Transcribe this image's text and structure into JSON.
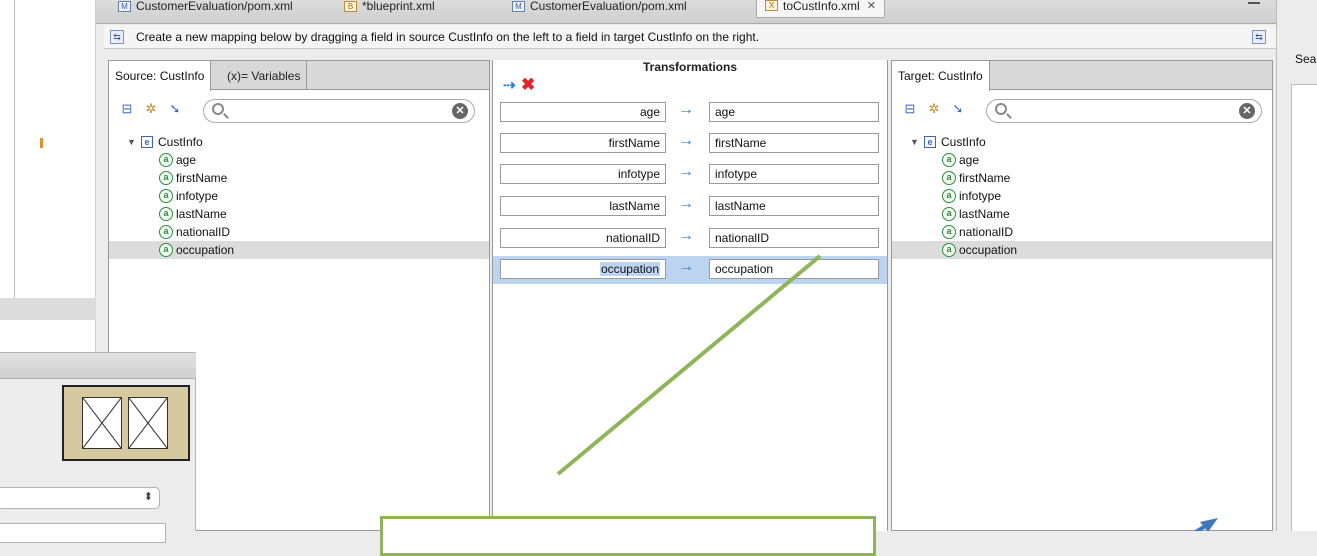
{
  "tabs": [
    {
      "label": "CustomerEvaluation/pom.xml",
      "icon": "M",
      "active": false
    },
    {
      "label": "*blueprint.xml",
      "icon": "B",
      "active": false
    },
    {
      "label": "CustomerEvaluation/pom.xml",
      "icon": "M",
      "active": false
    },
    {
      "label": "toCustInfo.xml",
      "icon": "X",
      "active": true
    }
  ],
  "info_bar": {
    "text": "Create a new mapping below by dragging a field in source CustInfo on the left to a field in target CustInfo on the right."
  },
  "source_panel": {
    "tab_label": "Source: CustInfo",
    "variables_tab_label": "(x)= Variables",
    "root": "CustInfo",
    "fields": [
      "age",
      "firstName",
      "infotype",
      "lastName",
      "nationalID",
      "occupation"
    ],
    "selected": "occupation"
  },
  "transformations": {
    "title": "Transformations",
    "mappings": [
      {
        "source": "age",
        "target": "age"
      },
      {
        "source": "firstName",
        "target": "firstName"
      },
      {
        "source": "infotype",
        "target": "infotype"
      },
      {
        "source": "lastName",
        "target": "lastName"
      },
      {
        "source": "nationalID",
        "target": "nationalID"
      },
      {
        "source": "occupation",
        "target": "occupation"
      }
    ],
    "selected_index": 5,
    "arrow_glyph": "→"
  },
  "target_panel": {
    "tab_label": "Target: CustInfo",
    "root": "CustInfo",
    "fields": [
      "age",
      "firstName",
      "infotype",
      "lastName",
      "nationalID",
      "occupation"
    ],
    "selected": "occupation"
  },
  "right_view": {
    "label": "Sea"
  },
  "colors": {
    "accent_blue": "#2a83d6",
    "delete_red": "#e0242a",
    "selection_blue": "#bcd4f0",
    "annotation_green": "#8fb55a",
    "annotation_blue": "#3f78b8"
  }
}
